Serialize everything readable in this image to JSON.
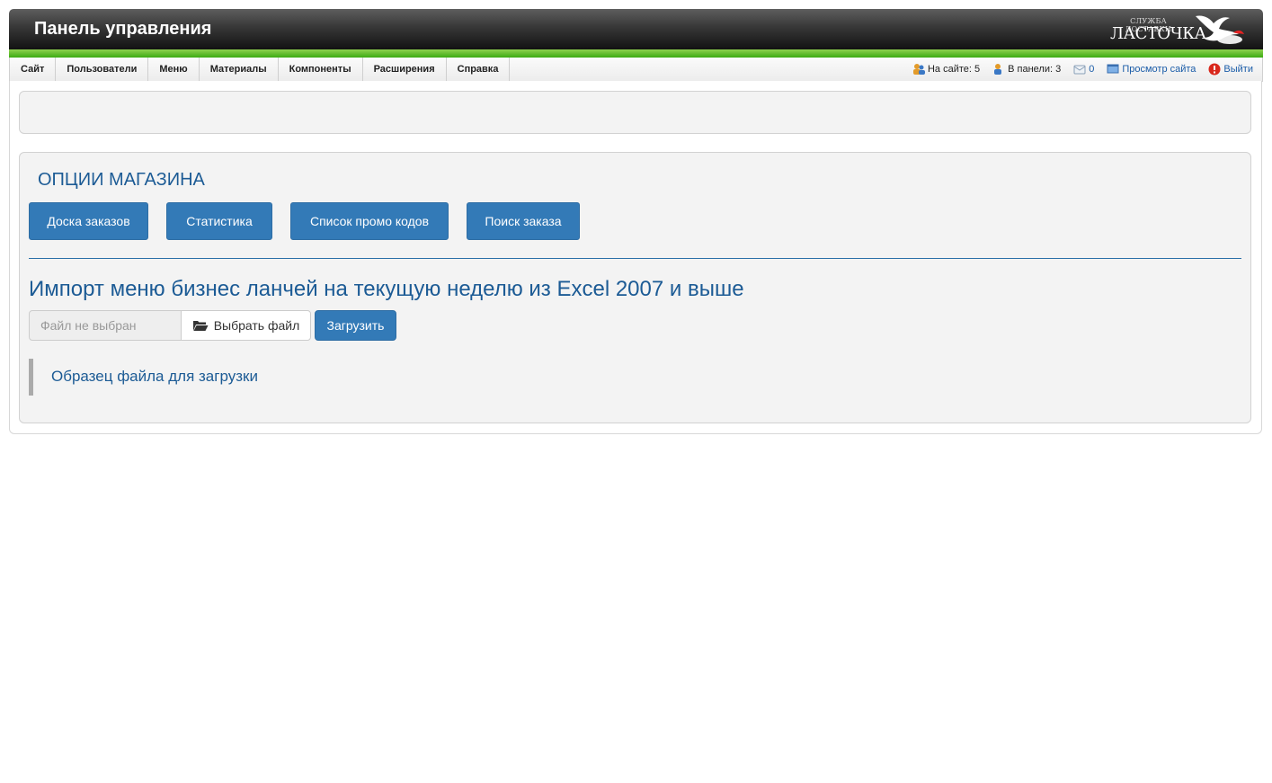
{
  "header": {
    "title": "Панель управления",
    "logo_small": "СЛУЖБА ДОСТАВКИ",
    "logo_big": "ЛАСТОЧКА"
  },
  "menu": {
    "items": [
      "Сайт",
      "Пользователи",
      "Меню",
      "Материалы",
      "Компоненты",
      "Расширения",
      "Справка"
    ]
  },
  "status": {
    "on_site": "На сайте: 5",
    "in_panel": "В панели: 3",
    "messages": "0",
    "view_site": "Просмотр сайта",
    "logout": "Выйти"
  },
  "shop": {
    "title": "ОПЦИИ МАГАЗИНА",
    "buttons": [
      "Доска заказов",
      "Статистика",
      "Список промо кодов",
      "Поиск заказа"
    ]
  },
  "import": {
    "title": "Импорт меню бизнес ланчей на текущую неделю из Excel 2007 и выше",
    "file_placeholder": "Файл не выбран",
    "choose_label": "Выбрать файл",
    "upload_label": "Загрузить",
    "sample_link": "Образец файла для загрузки"
  },
  "colors": {
    "accent_blue": "#337ab7",
    "title_blue": "#1c5b95",
    "green_bar": "#3cac13",
    "logout_icon": "#d9281c"
  },
  "icons": [
    "users-online-icon",
    "admin-users-icon",
    "messages-icon",
    "view-site-icon",
    "logout-icon",
    "folder-open-icon",
    "swallow-logo-icon"
  ]
}
